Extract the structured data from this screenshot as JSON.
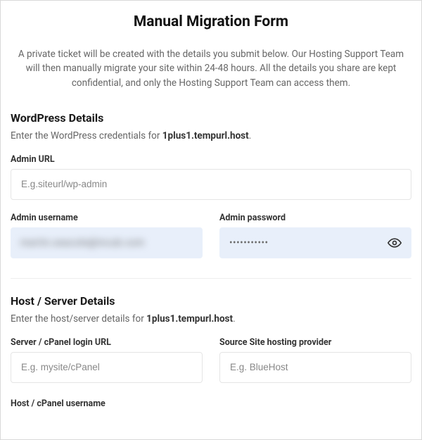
{
  "title": "Manual Migration Form",
  "intro": "A private ticket will be created with the details you submit below. Our Hosting Support Team will then manually migrate your site within 24-48 hours. All the details you share are kept confidential, and only the Hosting Support Team can access them.",
  "wp": {
    "heading": "WordPress Details",
    "sub_prefix": "Enter the WordPress credentials for ",
    "sub_host": "1plus1.tempurl.host",
    "sub_suffix": ".",
    "admin_url_label": "Admin URL",
    "admin_url_placeholder": "E.g.siteurl/wp-admin",
    "admin_url_value": "",
    "admin_username_label": "Admin username",
    "admin_username_value": "martin.seacole@incub.com",
    "admin_password_label": "Admin password",
    "admin_password_value": "•••••••••••"
  },
  "host": {
    "heading": "Host / Server Details",
    "sub_prefix": "Enter the host/server details for ",
    "sub_host": "1plus1.tempurl.host",
    "sub_suffix": ".",
    "login_url_label": "Server / cPanel login URL",
    "login_url_placeholder": "E.g. mysite/cPanel",
    "login_url_value": "",
    "provider_label": "Source Site hosting provider",
    "provider_placeholder": "E.g. BlueHost",
    "provider_value": "",
    "cutoff_label_left": "Host / cPanel username"
  }
}
